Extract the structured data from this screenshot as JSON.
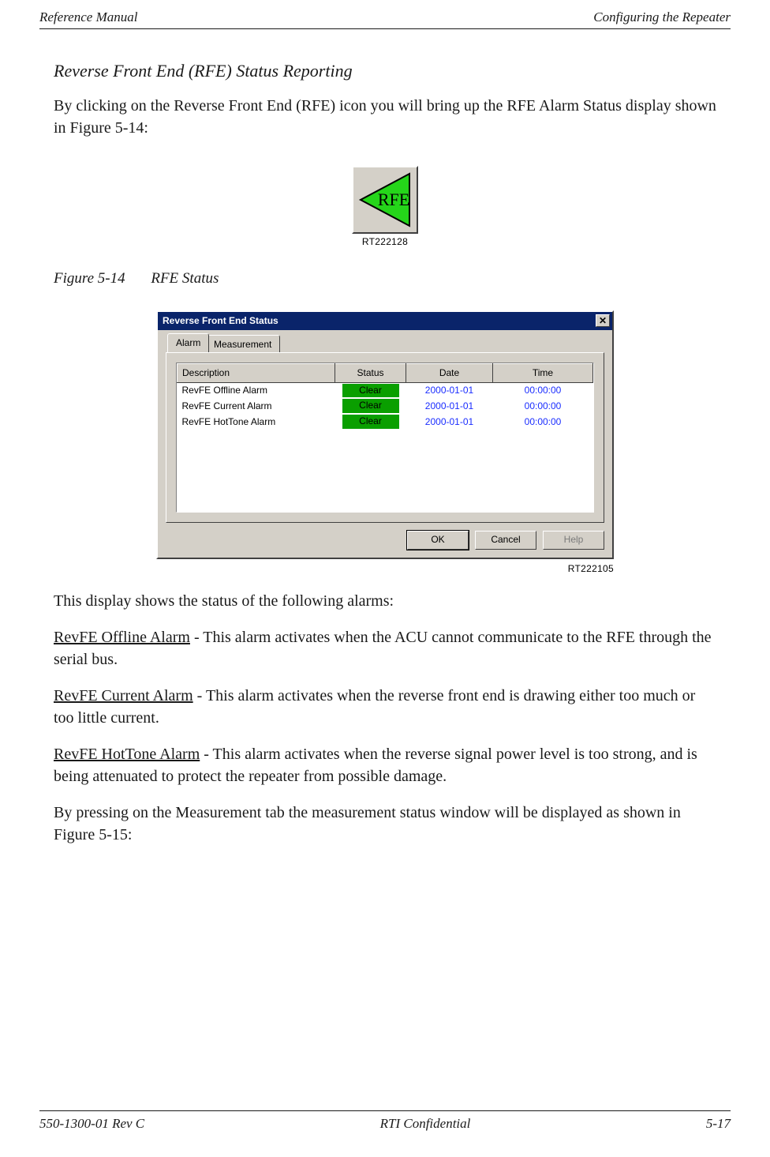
{
  "header": {
    "left": "Reference Manual",
    "right": "Configuring the Repeater"
  },
  "section": {
    "title": "Reverse Front End (RFE) Status Reporting"
  },
  "intro_para": "By clicking on the Reverse Front End (RFE) icon you will bring up the RFE Alarm Status display shown in Figure 5-14:",
  "rfe_icon": {
    "label": "RFE",
    "ref": "RT222128",
    "semantic": "rfe-icon"
  },
  "figure": {
    "label": "Figure 5-14",
    "caption": "RFE Status"
  },
  "dialog": {
    "title": "Reverse Front End Status",
    "close_glyph": "✕",
    "tabs": [
      {
        "label": "Alarm",
        "active": true
      },
      {
        "label": "Measurement",
        "active": false
      }
    ],
    "columns": {
      "description": "Description",
      "status": "Status",
      "date": "Date",
      "time": "Time"
    },
    "rows": [
      {
        "description": "RevFE Offline Alarm",
        "status": "Clear",
        "date": "2000-01-01",
        "time": "00:00:00"
      },
      {
        "description": "RevFE Current Alarm",
        "status": "Clear",
        "date": "2000-01-01",
        "time": "00:00:00"
      },
      {
        "description": "RevFE HotTone Alarm",
        "status": "Clear",
        "date": "2000-01-01",
        "time": "00:00:00"
      }
    ],
    "buttons": {
      "ok": "OK",
      "cancel": "Cancel",
      "help": "Help"
    },
    "ref": "RT222105"
  },
  "body": {
    "lead": "This display shows the status of the following alarms:",
    "alarm1_name": "RevFE Offline Alarm",
    "alarm1_desc": " - This alarm activates when the ACU cannot communicate to the RFE through the serial bus.",
    "alarm2_name": "RevFE Current Alarm",
    "alarm2_desc": " - This alarm activates when the reverse front end is drawing either too much or too little current.",
    "alarm3_name": "RevFE HotTone Alarm",
    "alarm3_desc": " - This alarm activates when the reverse signal power level is too strong, and is being attenuated to protect the repeater from possible damage.",
    "outro": "By pressing on the Measurement tab the measurement status window will be displayed as shown in Figure 5-15:"
  },
  "footer": {
    "left": "550-1300-01 Rev C",
    "center": "RTI Confidential",
    "right": "5-17"
  }
}
